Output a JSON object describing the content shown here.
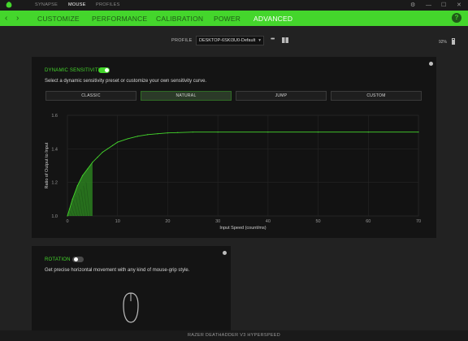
{
  "titlebar": {
    "tabs": [
      "SYNAPSE",
      "MOUSE",
      "PROFILES"
    ],
    "active_tab": "MOUSE",
    "controls": {
      "settings": "⚙",
      "minimize": "—",
      "maximize": "☐",
      "close": "✕"
    }
  },
  "nav": {
    "back": "‹",
    "forward": "›",
    "items": [
      "CUSTOMIZE",
      "PERFORMANCE",
      "CALIBRATION",
      "POWER",
      "ADVANCED"
    ],
    "active": "ADVANCED",
    "help": "?"
  },
  "profile": {
    "label": "PROFILE",
    "value": "DESKTOP-6SKI3U0-Default",
    "more": "•••",
    "battery": "92%"
  },
  "dynamic_sensitivity": {
    "title": "DYNAMIC SENSITIVITY",
    "enabled": true,
    "description": "Select a dynamic sensitivity preset or customize your own sensitivity curve.",
    "presets": [
      "CLASSIC",
      "NATURAL",
      "JUMP",
      "CUSTOM"
    ],
    "selected_preset": "NATURAL"
  },
  "chart_data": {
    "type": "line",
    "title": "",
    "xlabel": "Input Speed (count/ms)",
    "ylabel": "Ratio of Output to Input",
    "xlim": [
      0,
      70
    ],
    "ylim": [
      1.0,
      1.6
    ],
    "x_ticks": [
      "0",
      "10",
      "20",
      "30",
      "40",
      "50",
      "60",
      "70"
    ],
    "y_ticks": [
      "1.0",
      "1.2",
      "1.4",
      "1.6"
    ],
    "grid": true,
    "x": [
      0,
      1,
      2,
      3,
      4,
      5,
      6,
      7,
      8,
      9,
      10,
      12,
      14,
      16,
      18,
      20,
      22,
      25,
      30,
      40,
      50,
      60,
      70
    ],
    "y": [
      1.0,
      1.1,
      1.18,
      1.24,
      1.28,
      1.32,
      1.35,
      1.38,
      1.4,
      1.42,
      1.44,
      1.46,
      1.475,
      1.485,
      1.49,
      1.495,
      1.497,
      1.5,
      1.5,
      1.5,
      1.5,
      1.5,
      1.5
    ],
    "highlight_x_max": 5,
    "line_color": "#44d62c"
  },
  "rotation": {
    "title": "ROTATION",
    "enabled": false,
    "description": "Get precise horizontal movement with any kind of mouse-grip style."
  },
  "footer": {
    "device": "RAZER DEATHADDER V3 HYPERSPEED"
  },
  "colors": {
    "accent": "#44d62c",
    "background": "#222222",
    "card": "#141414"
  }
}
